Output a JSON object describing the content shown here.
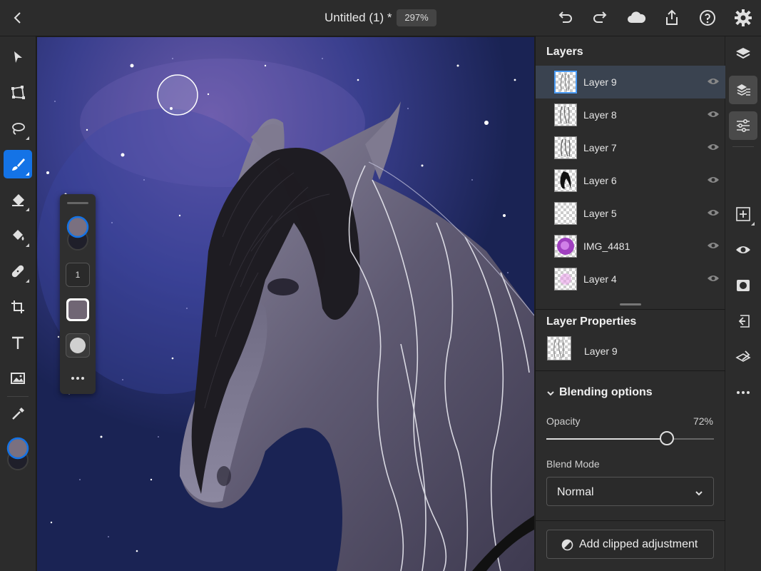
{
  "header": {
    "title": "Untitled (1) *",
    "zoom": "297%"
  },
  "layers_panel": {
    "title": "Layers",
    "layers": [
      {
        "name": "Layer 9",
        "selected": true
      },
      {
        "name": "Layer 8",
        "selected": false
      },
      {
        "name": "Layer 7",
        "selected": false
      },
      {
        "name": "Layer 6",
        "selected": false
      },
      {
        "name": "Layer 5",
        "selected": false
      },
      {
        "name": "IMG_4481",
        "selected": false
      },
      {
        "name": "Layer 4",
        "selected": false
      }
    ]
  },
  "properties": {
    "title": "Layer Properties",
    "layer_name": "Layer 9",
    "blending_title": "Blending options",
    "opacity_label": "Opacity",
    "opacity_value": "72%",
    "opacity_fraction": 0.72,
    "blend_mode_label": "Blend Mode",
    "blend_mode_value": "Normal",
    "adjust_button_label": "Add clipped adjustment"
  },
  "brush_panel": {
    "size_value": "1"
  },
  "colors": {
    "accent": "#1473e6",
    "primary_swatch": "#7a7080",
    "secondary_swatch": "#1f1f2a",
    "brush_preview": "#706674",
    "panel_bg": "#2c2c2c"
  },
  "icons": {
    "top": [
      "back-icon",
      "undo-icon",
      "redo-icon",
      "cloud-icon",
      "share-icon",
      "help-icon",
      "settings-icon"
    ],
    "left": [
      "select-icon",
      "transform-icon",
      "lasso-icon",
      "brush-icon",
      "eraser-icon",
      "fill-icon",
      "heal-icon",
      "crop-icon",
      "text-icon",
      "image-icon",
      "eyedropper-icon"
    ],
    "rail": [
      "layers-icon",
      "layer-stack-icon",
      "adjustments-icon",
      "add-layer-icon",
      "visibility-icon",
      "mask-icon",
      "import-icon",
      "clear-layer-icon",
      "more-icon"
    ]
  }
}
